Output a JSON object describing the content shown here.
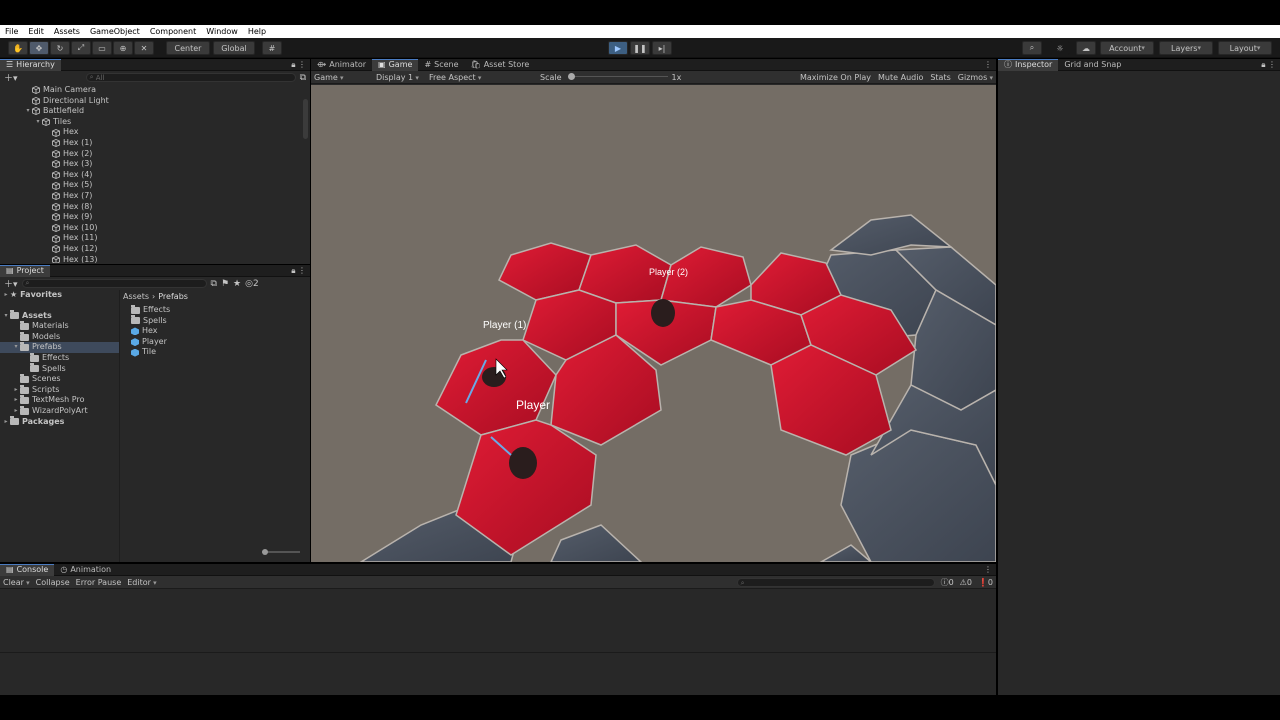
{
  "menu": [
    "File",
    "Edit",
    "Assets",
    "GameObject",
    "Component",
    "Window",
    "Help"
  ],
  "toolbar": {
    "center": "Center",
    "global": "Global",
    "account": "Account",
    "layers": "Layers",
    "layout": "Layout"
  },
  "hierarchy": {
    "title": "Hierarchy",
    "search_placeholder": "All",
    "items": [
      {
        "label": "Main Camera",
        "depth": 1,
        "arrow": ""
      },
      {
        "label": "Directional Light",
        "depth": 1,
        "arrow": ""
      },
      {
        "label": "Battlefield",
        "depth": 1,
        "arrow": "▾"
      },
      {
        "label": "Tiles",
        "depth": 2,
        "arrow": "▾"
      },
      {
        "label": "Hex",
        "depth": 3,
        "arrow": ""
      },
      {
        "label": "Hex (1)",
        "depth": 3,
        "arrow": ""
      },
      {
        "label": "Hex (2)",
        "depth": 3,
        "arrow": ""
      },
      {
        "label": "Hex (3)",
        "depth": 3,
        "arrow": ""
      },
      {
        "label": "Hex (4)",
        "depth": 3,
        "arrow": ""
      },
      {
        "label": "Hex (5)",
        "depth": 3,
        "arrow": ""
      },
      {
        "label": "Hex (7)",
        "depth": 3,
        "arrow": ""
      },
      {
        "label": "Hex (8)",
        "depth": 3,
        "arrow": ""
      },
      {
        "label": "Hex (9)",
        "depth": 3,
        "arrow": ""
      },
      {
        "label": "Hex (10)",
        "depth": 3,
        "arrow": ""
      },
      {
        "label": "Hex (11)",
        "depth": 3,
        "arrow": ""
      },
      {
        "label": "Hex (12)",
        "depth": 3,
        "arrow": ""
      },
      {
        "label": "Hex (13)",
        "depth": 3,
        "arrow": ""
      }
    ]
  },
  "project": {
    "title": "Project",
    "hidden_count": "2",
    "tree": [
      {
        "label": "Favorites",
        "depth": 0,
        "arrow": "▸",
        "icon": "star",
        "bold": true
      },
      {
        "label": "Assets",
        "depth": 0,
        "arrow": "▾",
        "icon": "folder",
        "bold": true
      },
      {
        "label": "Materials",
        "depth": 1,
        "arrow": "",
        "icon": "folder"
      },
      {
        "label": "Models",
        "depth": 1,
        "arrow": "",
        "icon": "folder"
      },
      {
        "label": "Prefabs",
        "depth": 1,
        "arrow": "▾",
        "icon": "folder",
        "selected": true
      },
      {
        "label": "Effects",
        "depth": 2,
        "arrow": "",
        "icon": "folder"
      },
      {
        "label": "Spells",
        "depth": 2,
        "arrow": "",
        "icon": "folder"
      },
      {
        "label": "Scenes",
        "depth": 1,
        "arrow": "",
        "icon": "folder"
      },
      {
        "label": "Scripts",
        "depth": 1,
        "arrow": "▸",
        "icon": "folder"
      },
      {
        "label": "TextMesh Pro",
        "depth": 1,
        "arrow": "▸",
        "icon": "folder"
      },
      {
        "label": "WizardPolyArt",
        "depth": 1,
        "arrow": "▸",
        "icon": "folder"
      },
      {
        "label": "Packages",
        "depth": 0,
        "arrow": "▸",
        "icon": "folder",
        "bold": true
      }
    ],
    "breadcrumb": [
      "Assets",
      "Prefabs"
    ],
    "contents": [
      {
        "label": "Effects",
        "icon": "folder"
      },
      {
        "label": "Spells",
        "icon": "folder"
      },
      {
        "label": "Hex",
        "icon": "prefab"
      },
      {
        "label": "Player",
        "icon": "prefab"
      },
      {
        "label": "Tile",
        "icon": "prefab"
      }
    ]
  },
  "game": {
    "tabs": [
      "Animator",
      "Game",
      "Scene",
      "Asset Store"
    ],
    "mode": "Game",
    "display": "Display 1",
    "aspect": "Free Aspect",
    "scale_label": "Scale",
    "scale_value": "1x",
    "maximize": "Maximize On Play",
    "mute": "Mute Audio",
    "stats": "Stats",
    "gizmos": "Gizmos",
    "labels": {
      "p1": "Player (1)",
      "p2": "Player (2)",
      "p0": "Player"
    },
    "colors": {
      "ground": "#746d65",
      "red": "#c8102e",
      "grey": "#4a5260"
    }
  },
  "inspector": {
    "tabs": [
      "Inspector",
      "Grid and Snap"
    ]
  },
  "console": {
    "tabs": [
      "Console",
      "Animation"
    ],
    "clear": "Clear",
    "collapse": "Collapse",
    "error_pause": "Error Pause",
    "editor": "Editor",
    "counts": [
      "0",
      "0",
      "0"
    ]
  }
}
